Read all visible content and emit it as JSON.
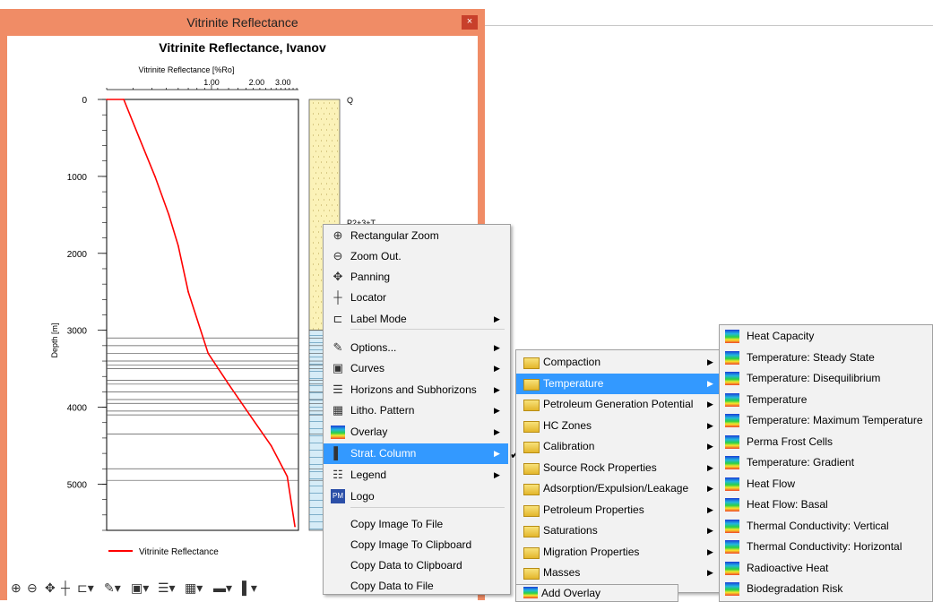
{
  "window": {
    "title": "Vitrinite Reflectance",
    "close": "×"
  },
  "chart_data": {
    "type": "line",
    "title": "Vitrinite Reflectance, Ivanov",
    "xlabel": "Vitrinite Reflectance [%Ro]",
    "ylabel": "Depth [m]",
    "x_scale": "log",
    "x_ticks": [
      "1.00",
      "2.00",
      "3.00"
    ],
    "y_ticks": [
      "0",
      "1000",
      "2000",
      "3000",
      "4000",
      "5000"
    ],
    "ylim": [
      0,
      5600
    ],
    "series": [
      {
        "name": "Vitrinite Reflectance",
        "color": "#ff0000",
        "x": [
          0.2,
          0.26,
          0.33,
          0.42,
          0.52,
          0.6,
          0.7,
          0.95,
          1.3,
          1.8,
          2.5,
          3.2,
          3.6
        ],
        "y": [
          0,
          0,
          500,
          1000,
          1500,
          1900,
          2500,
          3300,
          3700,
          4100,
          4500,
          4900,
          5550
        ]
      }
    ],
    "horizon_depths": [
      3100,
      3200,
      3300,
      3400,
      3450,
      3500,
      3650,
      3700,
      3800,
      3900,
      3950,
      4050,
      4100,
      4350,
      4800,
      4950
    ],
    "strat_labels": [
      "Q",
      "P2+3+T"
    ],
    "legend": [
      "Vitrinite Reflectance"
    ]
  },
  "context_menu": {
    "items": [
      {
        "label": "Rectangular Zoom",
        "icon": "zoom-in-icon"
      },
      {
        "label": "Zoom Out.",
        "icon": "zoom-out-icon"
      },
      {
        "label": "Panning",
        "icon": "pan-icon"
      },
      {
        "label": "Locator",
        "icon": "crosshair-icon"
      },
      {
        "label": "Label Mode",
        "icon": "label-icon",
        "submenu": true
      },
      {
        "label": "Options...",
        "icon": "wrench-icon",
        "submenu": true
      },
      {
        "label": "Curves",
        "icon": "curves-icon",
        "submenu": true
      },
      {
        "label": "Horizons and Subhorizons",
        "icon": "horizons-icon",
        "submenu": true
      },
      {
        "label": "Litho. Pattern",
        "icon": "litho-icon",
        "submenu": true
      },
      {
        "label": "Overlay",
        "icon": "overlay-icon",
        "submenu": true
      },
      {
        "label": "Strat. Column",
        "icon": "strat-column-icon",
        "submenu": true,
        "selected": true
      },
      {
        "label": "Legend",
        "icon": "legend-icon",
        "submenu": true
      },
      {
        "label": "Logo",
        "icon": "logo-icon"
      },
      {
        "label": "Copy Image To File"
      },
      {
        "label": "Copy Image To Clipboard"
      },
      {
        "label": "Copy Data to Clipboard"
      },
      {
        "label": "Copy Data to File"
      }
    ]
  },
  "overlay_menu": {
    "items": [
      {
        "label": "Compaction"
      },
      {
        "label": "Temperature",
        "selected": true
      },
      {
        "label": "Petroleum Generation Potential"
      },
      {
        "label": "HC Zones"
      },
      {
        "label": "Calibration"
      },
      {
        "label": "Source Rock Properties"
      },
      {
        "label": "Adsorption/Expulsion/Leakage"
      },
      {
        "label": "Petroleum Properties"
      },
      {
        "label": "Saturations"
      },
      {
        "label": "Migration Properties"
      },
      {
        "label": "Masses"
      }
    ],
    "add_overlay": "Add Overlay"
  },
  "temperature_menu": {
    "items": [
      "Heat Capacity",
      "Temperature: Steady State",
      "Temperature: Disequilibrium",
      "Temperature",
      "Temperature: Maximum Temperature",
      "Perma Frost Cells",
      "Temperature: Gradient",
      "Heat Flow",
      "Heat Flow: Basal",
      "Thermal Conductivity: Vertical",
      "Thermal Conductivity: Horizontal",
      "Radioactive Heat",
      "Biodegradation Risk"
    ]
  },
  "colors": {
    "window_frame": "#f08c66",
    "selection": "#3399ff",
    "curve": "#ff0000"
  }
}
